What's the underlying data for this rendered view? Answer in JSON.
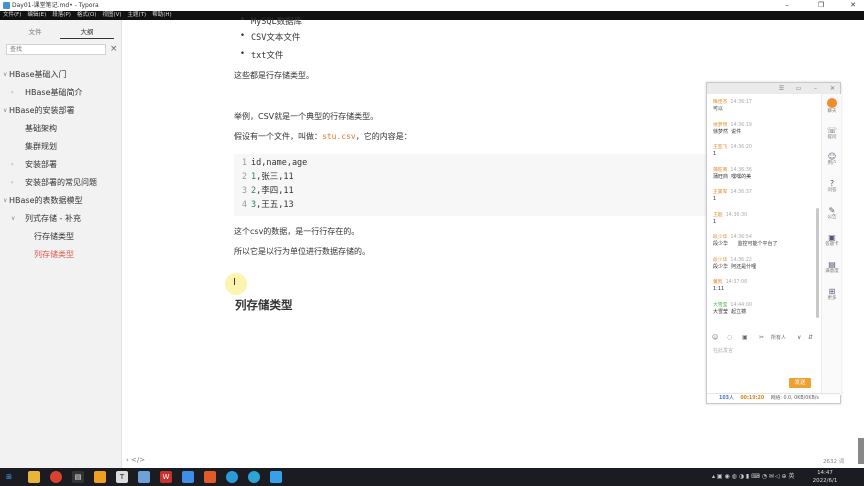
{
  "window": {
    "title": "Day01-课堂笔记.md• - Typora",
    "controls": [
      "–",
      "❐",
      "✕"
    ]
  },
  "menubar": [
    "文件(F)",
    "编辑(E)",
    "段落(P)",
    "格式(O)",
    "视图(V)",
    "主题(T)",
    "帮助(H)"
  ],
  "sidebar": {
    "tabs": [
      "文件",
      "大纲"
    ],
    "active_tab": "大纲",
    "search_placeholder": "查找",
    "close": "×",
    "outline": [
      {
        "label": "HBase基础入门",
        "level": 0,
        "arrow": "∨"
      },
      {
        "label": "HBase基础简介",
        "level": 1,
        "arrow": "›"
      },
      {
        "label": "HBase的安装部署",
        "level": 0,
        "arrow": "∨"
      },
      {
        "label": "基础架构",
        "level": 1,
        "arrow": ""
      },
      {
        "label": "集群规划",
        "level": 1,
        "arrow": ""
      },
      {
        "label": "安装部署",
        "level": 1,
        "arrow": "›"
      },
      {
        "label": "安装部署的常见问题",
        "level": 1,
        "arrow": "›"
      },
      {
        "label": "HBase的表数据模型",
        "level": 0,
        "arrow": "∨"
      },
      {
        "label": "列式存储 - 补充",
        "level": 1,
        "arrow": "∨"
      },
      {
        "label": "行存储类型",
        "level": 2,
        "arrow": ""
      },
      {
        "label": "列存储类型",
        "level": 2,
        "arrow": "",
        "active": true
      }
    ]
  },
  "editor": {
    "bullets": [
      "MySQL数据库",
      "CSV文本文件",
      "txt文件"
    ],
    "p1": "这些都是行存储类型。",
    "p2": "举例，CSV就是一个典型的行存储类型。",
    "p3_prefix": "假设有一个文件，叫做：",
    "p3_code": "stu.csv",
    "p3_suffix": "，它的内容是：",
    "code": [
      {
        "ln": "1",
        "num": "",
        "text": "id,name,age"
      },
      {
        "ln": "2",
        "num": "1",
        "text": ",张三,11"
      },
      {
        "ln": "3",
        "num": "2",
        "text": ",李四,11"
      },
      {
        "ln": "4",
        "num": "3",
        "text": ",王五,13"
      }
    ],
    "p4": "这个csv的数据，是一行行存在的。",
    "p5": "所以它是以行为单位进行数据存储的。",
    "heading": "列存储类型",
    "status_left": "‹  </>",
    "word_count": "2632 词"
  },
  "chat": {
    "top_controls": [
      "☰",
      "▭",
      "–",
      "✕"
    ],
    "rail": [
      {
        "icon": "●",
        "label": "聊天"
      },
      {
        "icon": "☏",
        "label": "提问"
      },
      {
        "icon": "☺",
        "label": "用户"
      },
      {
        "icon": "?",
        "label": "问答"
      },
      {
        "icon": "✎",
        "label": "公告"
      },
      {
        "icon": "▣",
        "label": "答题卡"
      },
      {
        "icon": "▤",
        "label": "满意度"
      },
      {
        "icon": "⊞",
        "label": "更多"
      }
    ],
    "messages": [
      {
        "who": "降佳杰",
        "time": "14:36:17",
        "body": "可以"
      },
      {
        "who": "徐梦然",
        "time": "14:36:19",
        "body": "徐梦然  说件"
      },
      {
        "who": "王亚飞",
        "time": "14:36:20",
        "body": "1"
      },
      {
        "who": "蒲旺商",
        "time": "14:36:36",
        "body": "蒲旺商  嘿嘿的美"
      },
      {
        "who": "王美军",
        "time": "14:36:37",
        "body": "1"
      },
      {
        "who": "王超",
        "time": "14:36:30",
        "body": "1"
      },
      {
        "who": "段少华",
        "time": "14:36:54",
        "body": "段少华      监控可能个平台了"
      },
      {
        "who": "段少华",
        "time": "14:36:22",
        "body": "段少华  阿还是什哩"
      },
      {
        "who": "董凯",
        "time": "14:37:08",
        "body": "1:11"
      },
      {
        "who": "大雪莹",
        "time": "14:44:00",
        "body": "大雪莹  起立撼",
        "green": true
      }
    ],
    "tools": [
      "☺",
      "◌",
      "▣",
      "✂",
      "所有人",
      "∨",
      "⇵"
    ],
    "input_placeholder": "在此发言",
    "send": "发送",
    "foot_count": "103人",
    "foot_time": "00:19:20",
    "foot_rest": "网络: 0.0, 0KB/0KB/s"
  },
  "taskbar": {
    "clock_time": "14:47",
    "clock_date": "2022/6/1"
  }
}
